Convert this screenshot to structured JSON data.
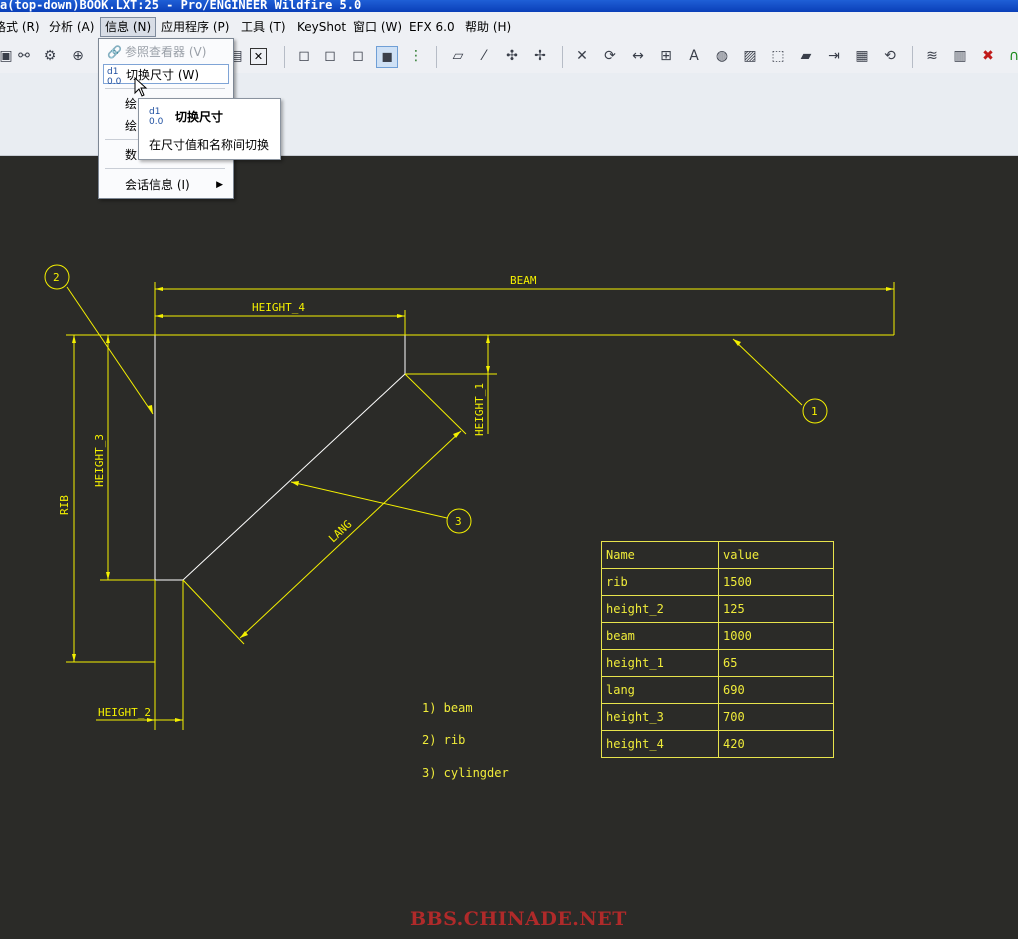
{
  "window": {
    "title": "a(top-down)BOOK.LXT:25 - Pro/ENGINEER Wildfire 5.0"
  },
  "menu": [
    {
      "label": "格式 (R)"
    },
    {
      "label": "分析 (A)"
    },
    {
      "label": "信息 (N)"
    },
    {
      "label": "应用程序 (P)"
    },
    {
      "label": "工具 (T)"
    },
    {
      "label": "KeyShot"
    },
    {
      "label": "窗口 (W)"
    },
    {
      "label": "EFX 6.0"
    },
    {
      "label": "帮助 (H)"
    }
  ],
  "info_menu": {
    "items": [
      {
        "label": "参照查看器 (V)"
      },
      {
        "label": "切换尺寸 (W)"
      },
      {
        "label": "绘"
      },
      {
        "label": "绘"
      },
      {
        "label": "数"
      },
      {
        "label": "会话信息 (I)"
      }
    ]
  },
  "tooltip": {
    "title": "切换尺寸",
    "description": "在尺寸值和名称间切换"
  },
  "drawing": {
    "dims": {
      "beam": "BEAM",
      "height_4": "HEIGHT_4",
      "height_1": "HEIGHT_1",
      "height_3": "HEIGHT_3",
      "rib": "RIB",
      "lang": "LANG",
      "height_2": "HEIGHT_2"
    },
    "balloons": {
      "b1": "1",
      "b2": "2",
      "b3": "3"
    },
    "notes": [
      "1) beam",
      "2) rib",
      "3) cylingder"
    ]
  },
  "parameter_table": {
    "header": [
      "Name",
      "value"
    ],
    "rows": [
      [
        "rib",
        "1500"
      ],
      [
        "height_2",
        "125"
      ],
      [
        "beam",
        "1000"
      ],
      [
        "height_1",
        "65"
      ],
      [
        "lang",
        "690"
      ],
      [
        "height_3",
        "700"
      ],
      [
        "height_4",
        "420"
      ]
    ]
  },
  "watermark": "BBS.CHINADE.NET",
  "colors": {
    "canvas": "#2b2b28",
    "annotation": "#f4f000",
    "geometry": "#ffffff",
    "watermark": "#b02a2a"
  }
}
